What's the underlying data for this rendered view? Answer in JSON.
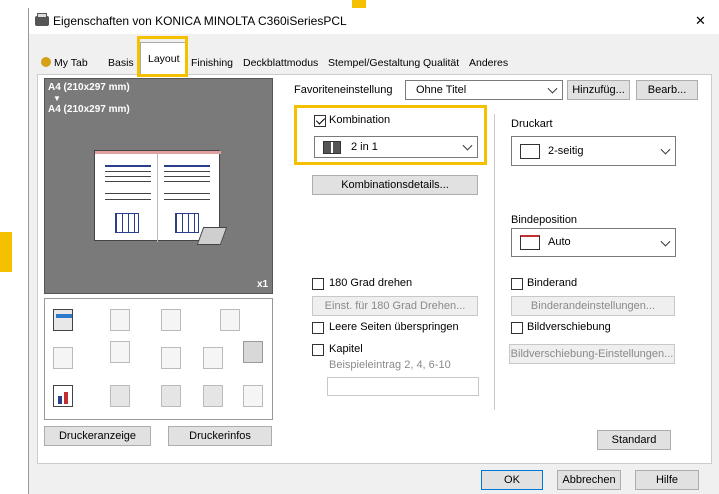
{
  "window": {
    "title": "Eigenschaften von KONICA MINOLTA C360iSeriesPCL",
    "close_glyph": "✕"
  },
  "tabs": [
    {
      "label": "My Tab"
    },
    {
      "label": "Basis"
    },
    {
      "label": "Layout",
      "active": true
    },
    {
      "label": "Finishing"
    },
    {
      "label": "Deckblattmodus"
    },
    {
      "label": "Stempel/Gestaltung"
    },
    {
      "label": "Qualität"
    },
    {
      "label": "Anderes"
    }
  ],
  "preview": {
    "source_size": "A4 (210x297 mm)",
    "arrow": "▼",
    "output_size": "A4 (210x297 mm)",
    "copies": "x1"
  },
  "favorites": {
    "label": "Favoriteneinstellung",
    "value": "Ohne Titel",
    "add_button": "Hinzufüg...",
    "edit_button": "Bearb..."
  },
  "combination": {
    "label": "Kombination",
    "checked": true,
    "value": "2 in 1",
    "details_button": "Kombinationsdetails..."
  },
  "print_type": {
    "label": "Druckart",
    "value": "2-seitig"
  },
  "binding_position": {
    "label": "Bindeposition",
    "value": "Auto"
  },
  "rotate180": {
    "label": "180 Grad drehen",
    "settings_button": "Einst. für 180 Grad Drehen..."
  },
  "skip_blank": {
    "label": "Leere Seiten überspringen"
  },
  "chapter": {
    "label": "Kapitel",
    "example": "Beispieleintrag 2, 4, 6-10",
    "value": ""
  },
  "binding_margin": {
    "label": "Binderand",
    "settings_button": "Binderandeinstellungen..."
  },
  "image_shift": {
    "label": "Bildverschiebung",
    "settings_button": "Bildverschiebung-Einstellungen..."
  },
  "left_buttons": {
    "printer_view": "Druckeranzeige",
    "printer_info": "Druckerinfos"
  },
  "standard_button": "Standard",
  "footer": {
    "ok": "OK",
    "cancel": "Abbrechen",
    "help": "Hilfe"
  },
  "colors": {
    "highlight": "#f5c000",
    "preview_bg": "#7a7a7a",
    "tab_bg": "#f0f0f0"
  }
}
